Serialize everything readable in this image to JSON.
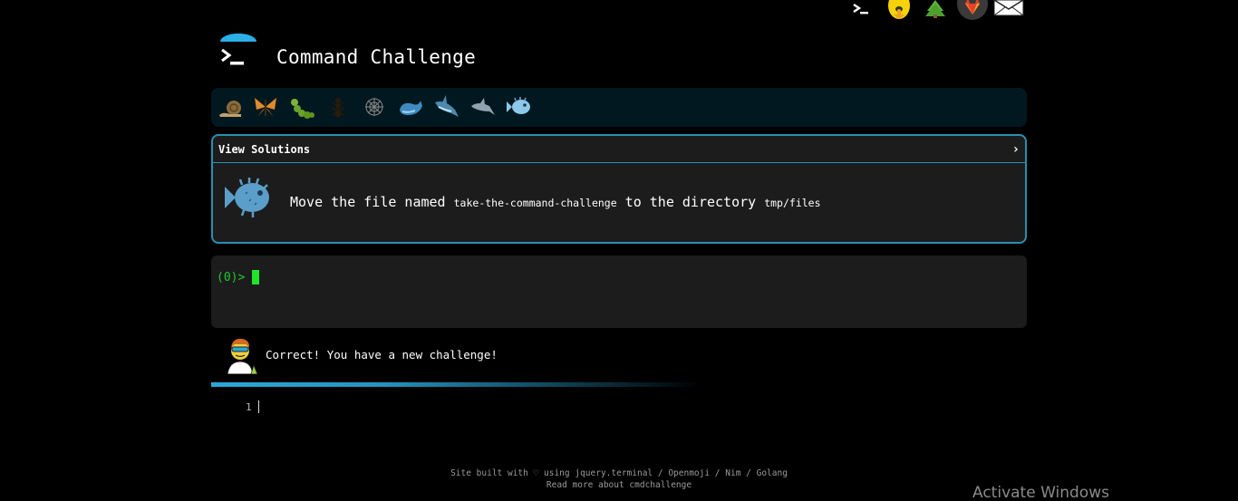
{
  "app": {
    "title": "Command Challenge"
  },
  "topnav": {
    "items": [
      "terminal-icon",
      "shushing-face-icon",
      "tree-icon",
      "gitlab-icon",
      "envelope-icon"
    ]
  },
  "levels": {
    "icons": [
      "snail-icon",
      "butterfly-icon",
      "caterpillar-icon",
      "ant-icon",
      "spider-web-icon",
      "whale-icon",
      "shark-icon",
      "dolphin-icon",
      "blowfish-icon"
    ]
  },
  "challenge": {
    "solutions_label": "View Solutions",
    "chevron": "›",
    "text_before": "Move the file named ",
    "file_name": "take-the-command-challenge",
    "text_middle": " to the directory ",
    "directory": "tmp/files"
  },
  "terminal": {
    "prompt": "(0)>"
  },
  "feedback": {
    "message": "Correct! You have a new challenge!"
  },
  "editor": {
    "line_number": "1"
  },
  "footer": {
    "line1_prefix": "Site built with ♡ using ",
    "links": [
      "jquery.terminal",
      "Openmoji",
      "Nim",
      "Golang"
    ],
    "sep": " / ",
    "line2": "Read more about cmdchallenge"
  },
  "system": {
    "watermark": "Activate Windows"
  },
  "colors": {
    "accent": "#2a8fb0",
    "prompt": "#22c932",
    "cursor": "#22e52a",
    "panel": "#1c1c1c",
    "levels_bg": "#021820"
  }
}
